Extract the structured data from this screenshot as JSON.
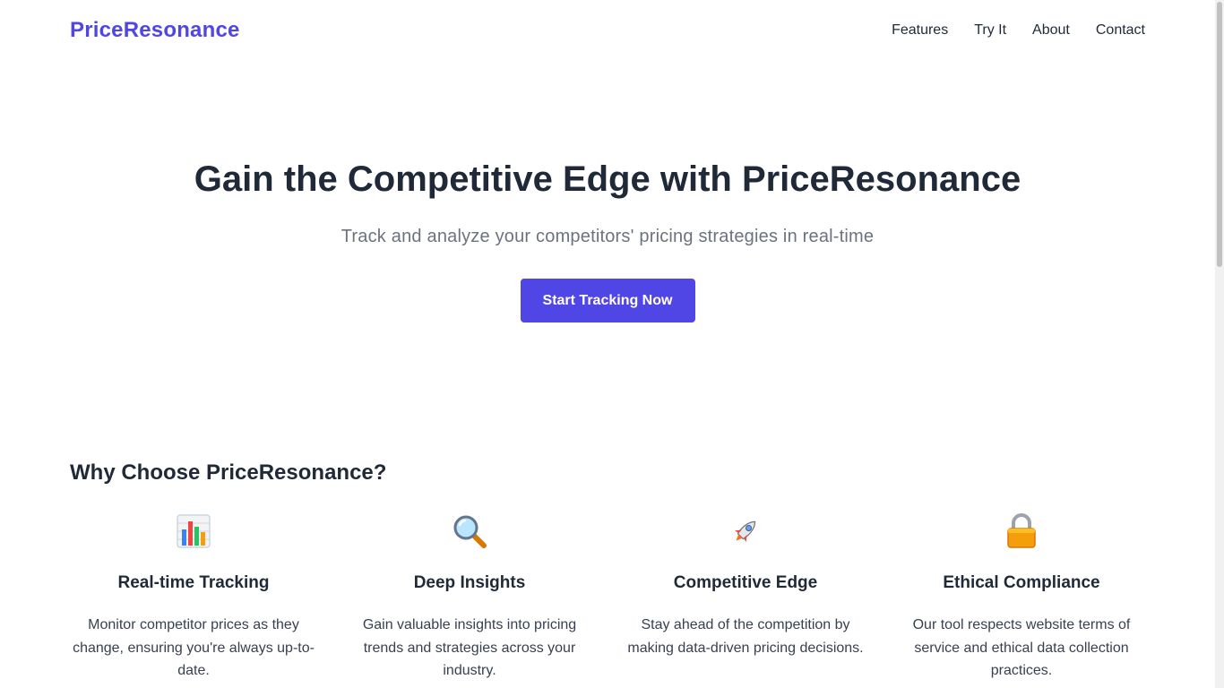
{
  "header": {
    "logo": "PriceResonance",
    "nav": [
      "Features",
      "Try It",
      "About",
      "Contact"
    ]
  },
  "hero": {
    "title": "Gain the Competitive Edge with PriceResonance",
    "subtitle": "Track and analyze your competitors' pricing strategies in real-time",
    "cta_label": "Start Tracking Now"
  },
  "features": {
    "title": "Why Choose PriceResonance?",
    "items": [
      {
        "icon": "bar-chart-icon",
        "title": "Real-time Tracking",
        "description": "Monitor competitor prices as they change, ensuring you're always up-to-date."
      },
      {
        "icon": "magnifier-icon",
        "title": "Deep Insights",
        "description": "Gain valuable insights into pricing trends and strategies across your industry."
      },
      {
        "icon": "rocket-icon",
        "title": "Competitive Edge",
        "description": "Stay ahead of the competition by making data-driven pricing decisions."
      },
      {
        "icon": "lock-icon",
        "title": "Ethical Compliance",
        "description": "Our tool respects website terms of service and ethical data collection practices."
      }
    ]
  },
  "colors": {
    "accent": "#4f46e5",
    "text": "#1f2937",
    "muted": "#6b7280"
  }
}
